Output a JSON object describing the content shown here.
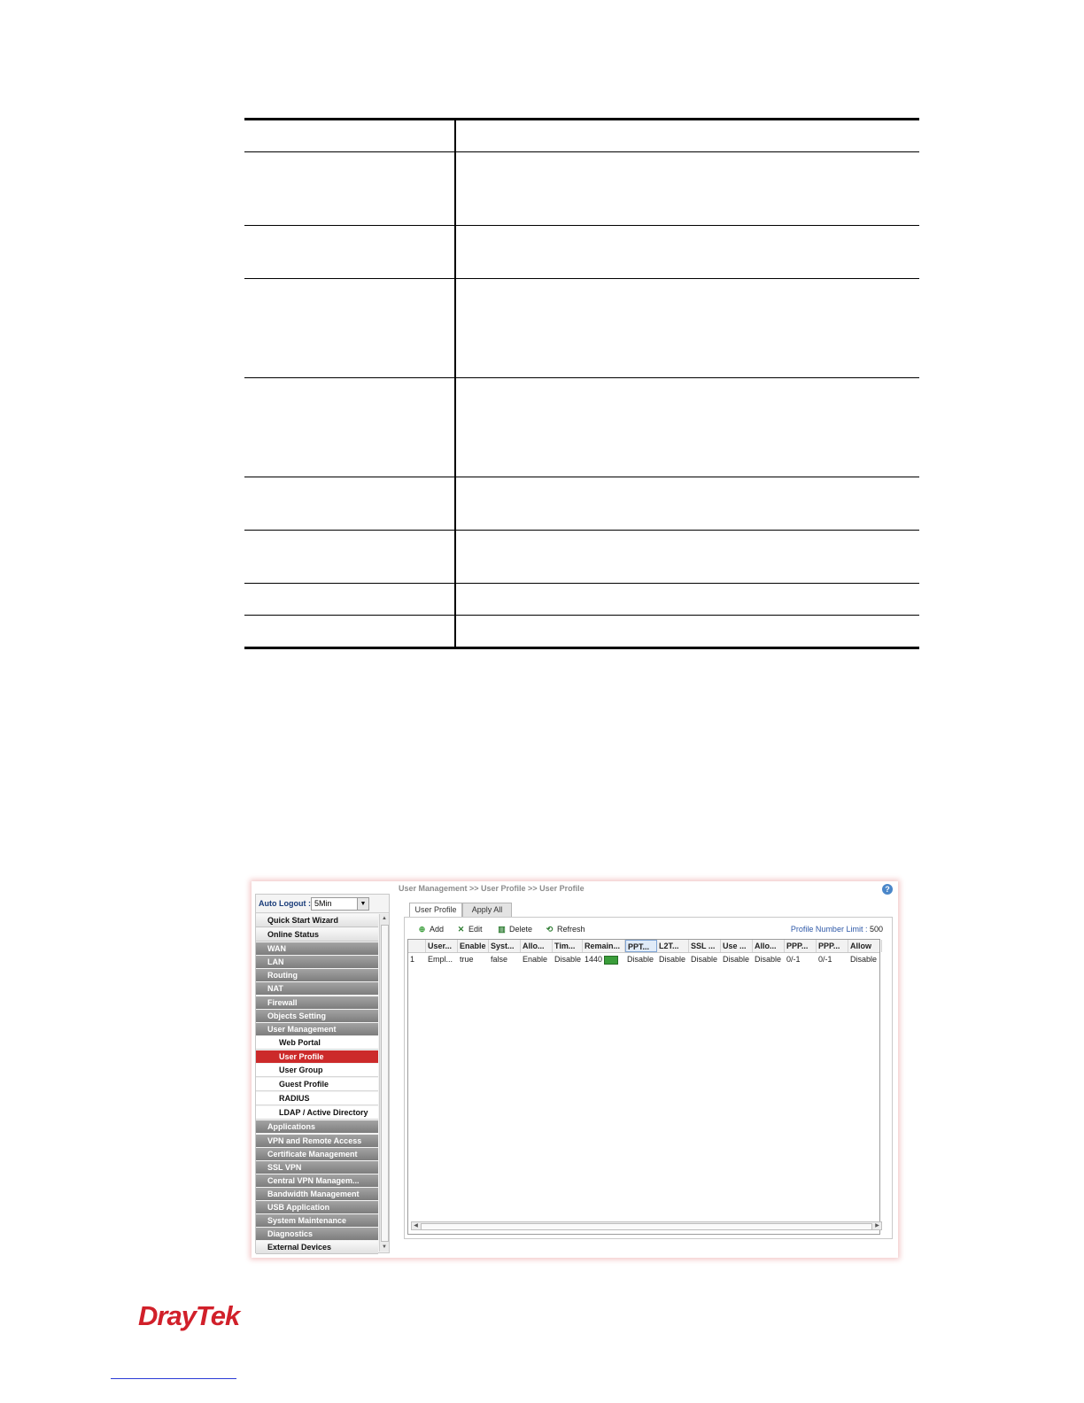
{
  "screenshot": {
    "breadcrumb": "User Management >> User Profile >> User Profile",
    "help_icon": "?",
    "auto_logout": {
      "label": "Auto Logout :",
      "value": "5Min"
    },
    "nav": [
      {
        "label": "Quick Start Wizard",
        "kind": "plain"
      },
      {
        "label": "Online Status",
        "kind": "plain"
      },
      {
        "label": "WAN",
        "kind": "gray"
      },
      {
        "label": "LAN",
        "kind": "gray"
      },
      {
        "label": "Routing",
        "kind": "gray"
      },
      {
        "label": "NAT",
        "kind": "gray"
      },
      {
        "label": "Firewall",
        "kind": "gray"
      },
      {
        "label": "Objects Setting",
        "kind": "gray"
      },
      {
        "label": "User Management",
        "kind": "gray"
      },
      {
        "label": "Web Portal",
        "kind": "sub"
      },
      {
        "label": "User Profile",
        "kind": "active"
      },
      {
        "label": "User Group",
        "kind": "sub"
      },
      {
        "label": "Guest Profile",
        "kind": "sub"
      },
      {
        "label": "RADIUS",
        "kind": "sub"
      },
      {
        "label": "LDAP / Active Directory",
        "kind": "sub"
      },
      {
        "label": "Applications",
        "kind": "gray"
      },
      {
        "label": "VPN and Remote Access",
        "kind": "gray"
      },
      {
        "label": "Certificate Management",
        "kind": "gray"
      },
      {
        "label": "SSL VPN",
        "kind": "gray"
      },
      {
        "label": "Central VPN Managem...",
        "kind": "gray"
      },
      {
        "label": "Bandwidth Management",
        "kind": "gray"
      },
      {
        "label": "USB Application",
        "kind": "gray"
      },
      {
        "label": "System Maintenance",
        "kind": "gray"
      },
      {
        "label": "Diagnostics",
        "kind": "gray"
      },
      {
        "label": "External Devices",
        "kind": "plain"
      }
    ],
    "tabs": {
      "active": "User Profile",
      "other": "Apply All"
    },
    "toolbar": {
      "add": "Add",
      "edit": "Edit",
      "delete": "Delete",
      "refresh": "Refresh",
      "limit_label": "Profile Number Limit :",
      "limit_value": "500"
    },
    "columns": [
      "",
      "User...",
      "Enable",
      "Syst...",
      "Allo...",
      "Tim...",
      "Remain...",
      "PPT...",
      "L2T...",
      "SSL ...",
      "Use ...",
      "Allo...",
      "PPP...",
      "PPP...",
      "Allow"
    ],
    "rows": [
      [
        "1",
        "Empl...",
        "true",
        "false",
        "Enable",
        "Disable",
        "1440",
        "Disable",
        "Disable",
        "Disable",
        "Disable",
        "Disable",
        "0/-1",
        "0/-1",
        "Disable"
      ]
    ]
  },
  "logo": {
    "text": "DrayTek"
  },
  "colors": {
    "active_nav": "#cc2a2a",
    "logo": "#d1202a",
    "link": "#2a3bd6"
  }
}
